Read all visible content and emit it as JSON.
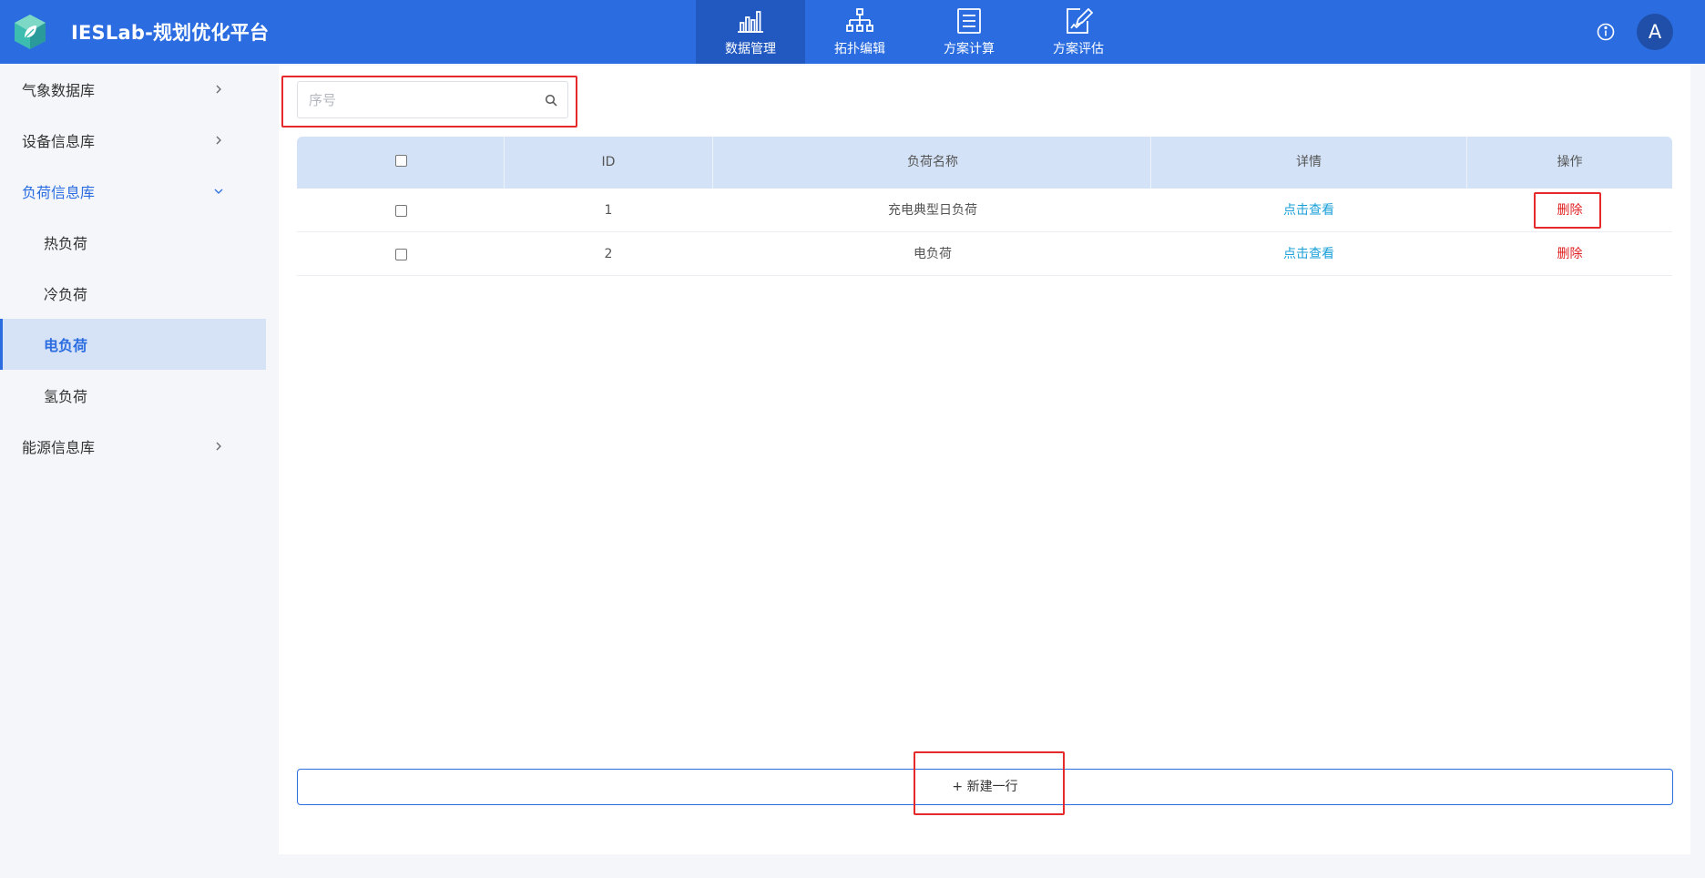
{
  "app": {
    "title": "IESLab-规划优化平台"
  },
  "nav": {
    "items": [
      {
        "label": "数据管理",
        "icon": "bar-chart-icon",
        "active": true
      },
      {
        "label": "拓扑编辑",
        "icon": "topology-icon",
        "active": false
      },
      {
        "label": "方案计算",
        "icon": "document-list-icon",
        "active": false
      },
      {
        "label": "方案评估",
        "icon": "edit-document-icon",
        "active": false
      }
    ]
  },
  "header": {
    "info_icon": "info-icon",
    "avatar_letter": "A"
  },
  "sidebar": {
    "items": [
      {
        "label": "气象数据库",
        "level": 1,
        "chevron": "right"
      },
      {
        "label": "设备信息库",
        "level": 1,
        "chevron": "right"
      },
      {
        "label": "负荷信息库",
        "level": 1,
        "chevron": "down",
        "open": true
      },
      {
        "label": "热负荷",
        "level": 2
      },
      {
        "label": "冷负荷",
        "level": 2
      },
      {
        "label": "电负荷",
        "level": 2,
        "selected": true
      },
      {
        "label": "氢负荷",
        "level": 2
      },
      {
        "label": "能源信息库",
        "level": 1,
        "chevron": "right"
      }
    ]
  },
  "search": {
    "placeholder": "序号",
    "value": ""
  },
  "table": {
    "columns": [
      "",
      "ID",
      "负荷名称",
      "详情",
      "操作"
    ],
    "rows": [
      {
        "id": "1",
        "name": "充电典型日负荷",
        "detail": "点击查看",
        "action": "删除"
      },
      {
        "id": "2",
        "name": "电负荷",
        "detail": "点击查看",
        "action": "删除"
      }
    ]
  },
  "add_row": {
    "label": "+ 新建一行"
  },
  "colors": {
    "header_bg": "#2b6de0",
    "nav_active_bg": "#2159c1",
    "table_header_bg": "#d3e2f6",
    "sidebar_selected_bg": "#d6e3f7",
    "link": "#1ba0d8",
    "delete": "#e02020",
    "highlight": "#e42a2a"
  }
}
